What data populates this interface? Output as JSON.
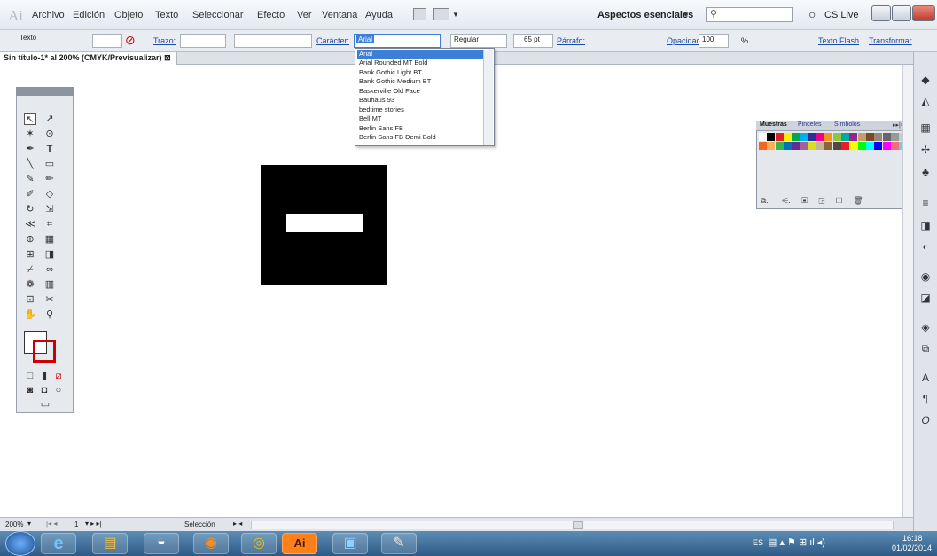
{
  "app": {
    "logo": "Ai"
  },
  "menu": {
    "items": [
      "Archivo",
      "Edición",
      "Objeto",
      "Texto",
      "Seleccionar",
      "Efecto",
      "Ver",
      "Ventana",
      "Ayuda"
    ],
    "workspace": "Aspectos esenciales",
    "cs_live": "CS Live"
  },
  "control": {
    "tool_label": "Texto",
    "stroke_label": "Trazo:",
    "character_label": "Carácter:",
    "font_value": "Arial",
    "style_value": "Regular",
    "size_value": "65 pt",
    "paragraph_label": "Párrafo:",
    "opacity_label": "Opacidad:",
    "opacity_value": "100",
    "opacity_unit": "%",
    "flash_text": "Texto Flash",
    "transform": "Transformar"
  },
  "document": {
    "tab": "Sin título-1* al 200% (CMYK/Previsualizar)"
  },
  "font_dropdown": {
    "items": [
      "Arial",
      "Arial Rounded MT Bold",
      "Bank Gothic Light BT",
      "Bank Gothic Medium BT",
      "Baskerville Old Face",
      "Bauhaus 93",
      "bedtime stories",
      "Bell MT",
      "Berlin Sans FB",
      "Berlin Sans FB Demi Bold"
    ],
    "selected": "Arial"
  },
  "swatches": {
    "tabs": [
      "Muestras",
      "Pinceles",
      "Símbolos"
    ]
  },
  "status": {
    "zoom": "200%",
    "page": "1",
    "mode": "Selección"
  },
  "taskbar": {
    "lang": "ES",
    "time": "16:18",
    "date": "01/02/2014"
  },
  "colors": {
    "accent": "#3c7fd7",
    "taskbar": "#2d5a86",
    "link": "#1d4aa8"
  }
}
